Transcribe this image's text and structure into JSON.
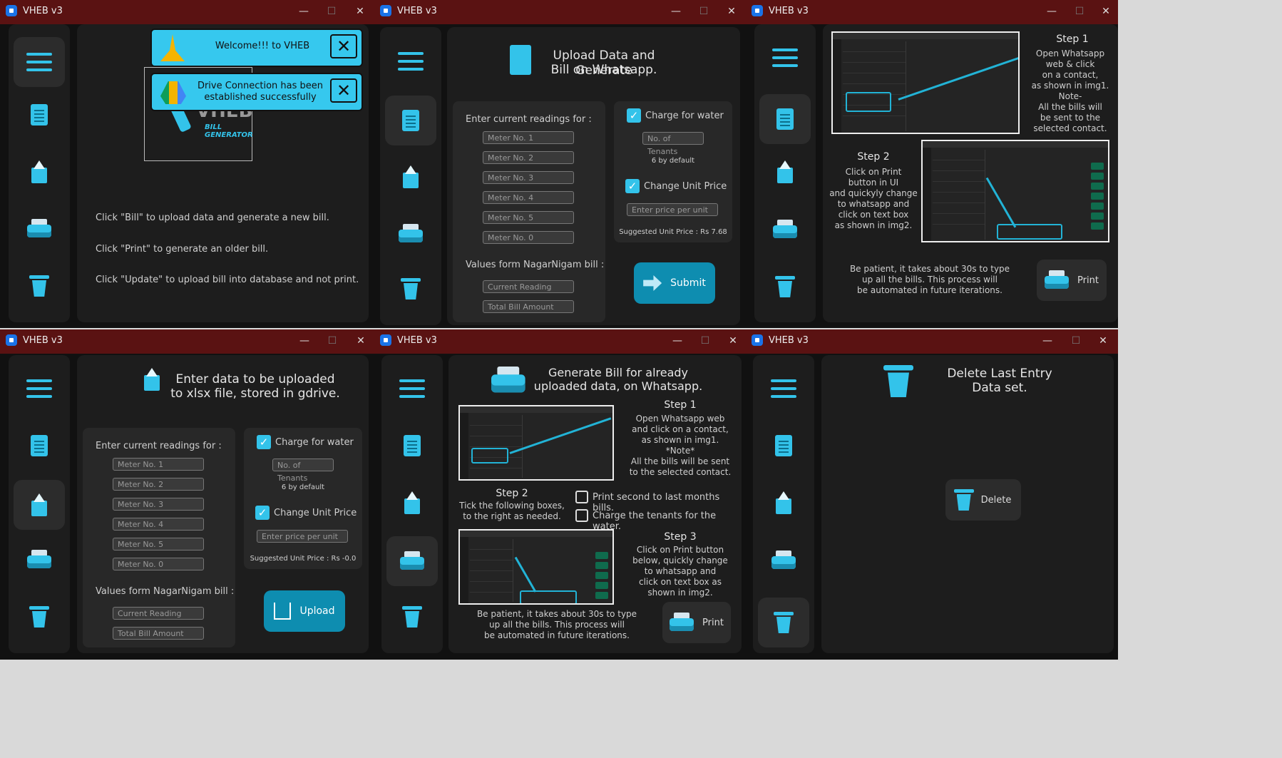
{
  "app_title": "VHEB v3",
  "window_controls": {
    "minimize": "—",
    "maximize": "☐",
    "close": "✕"
  },
  "home": {
    "toast1": "Welcome!!! to VHEB",
    "toast2_line1": "Drive Connection has been",
    "toast2_line2": "established successfully",
    "logo_text": "VHEB",
    "logo_sub": "BILL GENERATOR",
    "line1": "Click \"Bill\" to upload data and generate a new bill.",
    "line2": "Click \"Print\" to generate an older bill.",
    "line3": "Click \"Update\" to upload bill into database and not print."
  },
  "bill": {
    "head1": "Upload Data and Generate",
    "head2": "Bill on Whatsapp.",
    "readings_label": "Enter current readings for :",
    "meters": [
      "Meter No. 1",
      "Meter No. 2",
      "Meter No. 3",
      "Meter No. 4",
      "Meter No. 5",
      "Meter No. 0"
    ],
    "nagar_label": "Values form NagarNigam bill :",
    "current_reading": "Current Reading",
    "total_bill": "Total Bill Amount",
    "charge_water": "Charge for water",
    "tenants": "No. of Tenants",
    "default_note": "6 by default",
    "change_price": "Change Unit Price",
    "price_placeholder": "Enter price per unit",
    "suggested": "Suggested Unit Price : Rs 7.68",
    "submit": "Submit"
  },
  "print_help": {
    "step1_title": "Step 1",
    "step1_lines": [
      "Open Whatsapp",
      "web & click",
      "on a contact,",
      "as shown in img1.",
      "Note-",
      "All the bills will",
      "be sent to the",
      "selected contact."
    ],
    "step2_title": "Step 2",
    "step2_lines": [
      "Click on Print",
      "button in UI",
      "and quickyly change",
      "to whatsapp and",
      "click on text box",
      "as shown in img2."
    ],
    "patience_lines": [
      "Be patient, it takes about 30s to type",
      "up all the bills. This process will",
      "be automated in future iterations."
    ],
    "print_button": "Print"
  },
  "update": {
    "head1": "Enter data to be uploaded",
    "head2": "to xlsx file, stored in gdrive.",
    "readings_label": "Enter current readings for :",
    "meters": [
      "Meter No. 1",
      "Meter No. 2",
      "Meter No. 3",
      "Meter No. 4",
      "Meter No. 5",
      "Meter No. 0"
    ],
    "nagar_label": "Values form NagarNigam bill :",
    "current_reading": "Current Reading",
    "total_bill": "Total Bill Amount",
    "charge_water": "Charge for water",
    "tenants": "No. of Tenants",
    "default_note": "6 by default",
    "change_price": "Change Unit Price",
    "price_placeholder": "Enter price per unit",
    "suggested": "Suggested Unit Price : Rs -0.0",
    "upload": "Upload"
  },
  "print_old": {
    "head1": "Generate Bill for already",
    "head2": "uploaded data, on Whatsapp.",
    "step1_title": "Step 1",
    "step1_lines": [
      "Open  Whatsapp  web",
      "and click on a contact,",
      "as  shown  in  img1.",
      "*Note*",
      "All the  bills will be sent",
      "to the selected contact."
    ],
    "step2_title": "Step 2",
    "step2_lines": [
      "Tick the following boxes,",
      "to the right as needed."
    ],
    "opt1": "Print second to last months bills.",
    "opt2": "Charge the tenants for the water.",
    "step3_title": "Step 3",
    "step3_lines": [
      "Click on Print button",
      "below, quickly change",
      "to   whatsapp   and",
      "click  on  text  box as",
      "shown   in   img2."
    ],
    "patience_lines": [
      "Be patient, it takes about 30s to type",
      "up all the bills.  This  process  will",
      "be automated  in future iterations."
    ],
    "print_button": "Print"
  },
  "delete": {
    "head1": "Delete Last Entry",
    "head2": "Data set.",
    "button": "Delete"
  },
  "colors": {
    "accent": "#33c3ea",
    "titlebar": "#5a1212",
    "panel": "#1d1d1d",
    "bg": "#111111"
  }
}
